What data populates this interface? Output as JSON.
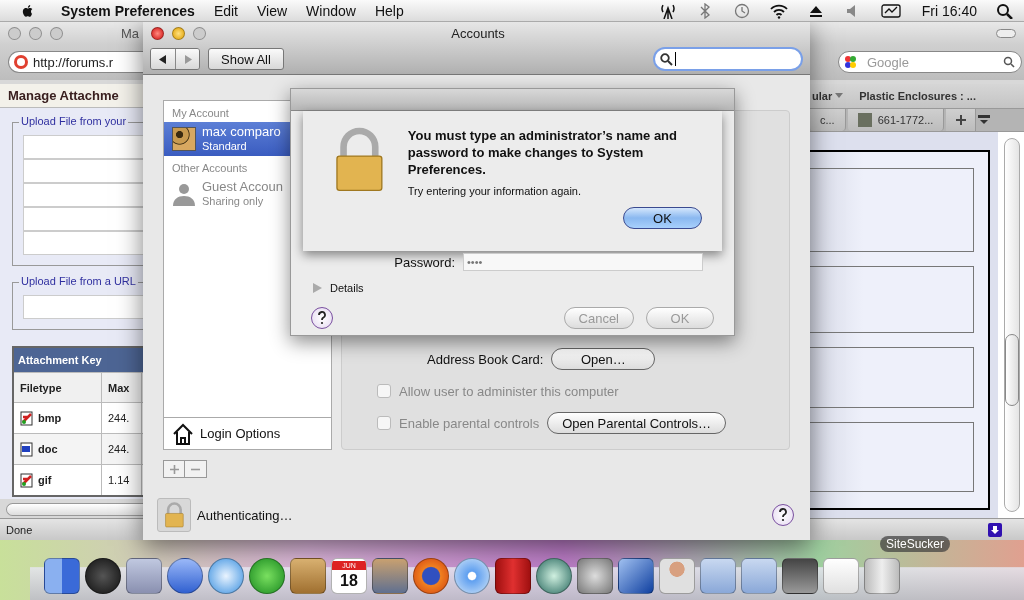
{
  "menu_bar": {
    "app_name": "System Preferences",
    "menus": [
      "Edit",
      "View",
      "Window",
      "Help"
    ],
    "clock": "Fri 16:40"
  },
  "browser": {
    "title": "Ma",
    "url": "http://forums.r",
    "search_placeholder": "Google",
    "bookmarks": [
      "ular",
      "Plastic Enclosures : ..."
    ],
    "tabs": [
      "c...",
      "661-1772..."
    ],
    "page": {
      "heading": "Manage Attachme",
      "upload_computer": "Upload File from your",
      "upload_url": "Upload File from a URL",
      "attachment_key": {
        "title": "Attachment Key",
        "columns": [
          "Filetype",
          "Max"
        ],
        "rows": [
          {
            "filetype": "bmp",
            "max": "244.",
            "kind": "image"
          },
          {
            "filetype": "doc",
            "max": "244.",
            "kind": "word"
          },
          {
            "filetype": "gif",
            "max": "1.14",
            "kind": "image"
          }
        ]
      }
    },
    "status": "Done"
  },
  "accounts_window": {
    "title": "Accounts",
    "show_all": "Show All",
    "sidebar": {
      "sections": [
        {
          "header": "My Account",
          "items": [
            {
              "name": "max comparo",
              "role": "Standard",
              "kind": "photo",
              "selected": true,
              "disabled": false
            }
          ]
        },
        {
          "header": "Other Accounts",
          "items": [
            {
              "name": "Guest Accoun",
              "role": "Sharing only",
              "kind": "guest",
              "selected": false,
              "disabled": true
            }
          ]
        }
      ],
      "login_options": "Login Options"
    },
    "detail": {
      "address_book_label": "Address Book Card:",
      "open_button": "Open…",
      "options": [
        {
          "label": "Allow user to administer this computer",
          "checked": false,
          "disabled": true
        },
        {
          "label": "Enable parental controls",
          "checked": false,
          "disabled": true,
          "button": "Open Parental Controls…"
        }
      ]
    },
    "lock_status": "Authenticating…",
    "sheet": {
      "password_label": "Password:",
      "password_value": "••••",
      "details_label": "Details",
      "details_expanded": false,
      "buttons": [
        {
          "label": "Cancel",
          "disabled": true
        },
        {
          "label": "OK",
          "disabled": true
        }
      ]
    },
    "alert": {
      "title": "You must type an administrator’s name and password to make changes to System Preferences.",
      "message": "Try entering your information again.",
      "button": "OK"
    }
  },
  "dock": {
    "hover_label": "SiteSucker",
    "calendar_month": "JUN",
    "calendar_day": "18"
  }
}
